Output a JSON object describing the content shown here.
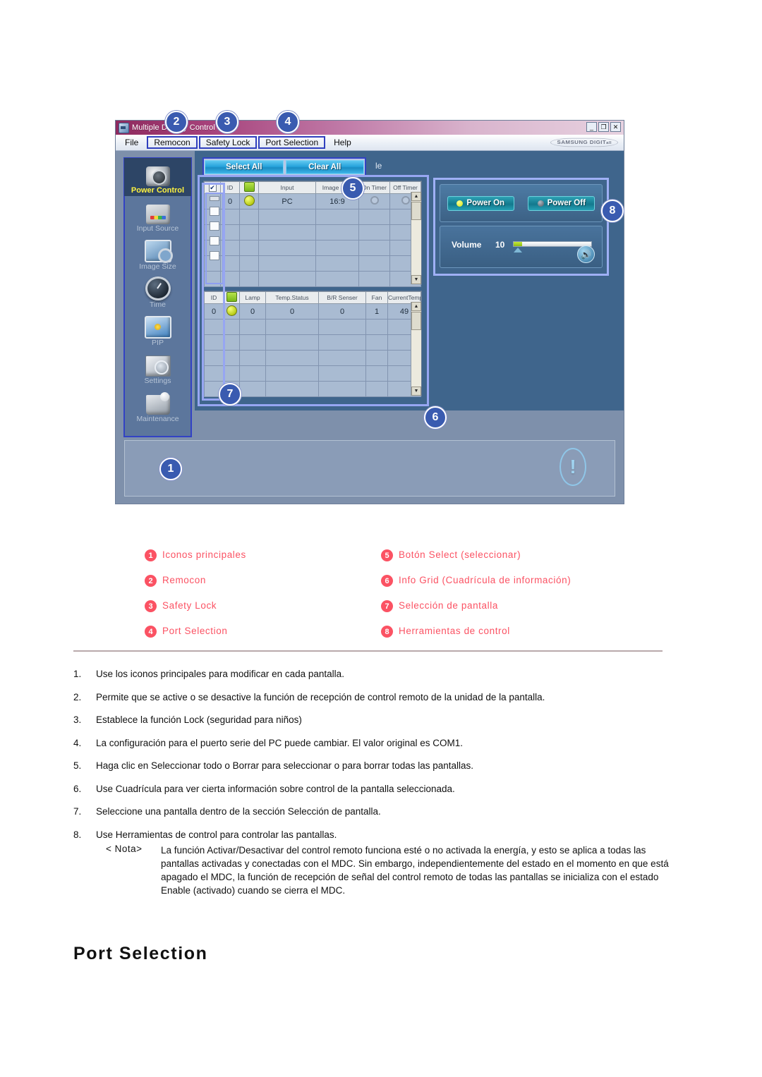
{
  "app": {
    "window_title": "Multiple Display Control",
    "window_buttons": {
      "minimize": "_",
      "maximize": "❐",
      "close": "✕"
    },
    "brand": "SAMSUNG DIGIT",
    "brand_suffix": "all",
    "menu": [
      {
        "label": "File",
        "boxed": false
      },
      {
        "label": "Remocon",
        "boxed": true
      },
      {
        "label": "Safety Lock",
        "boxed": true
      },
      {
        "label": "Port Selection",
        "boxed": true
      },
      {
        "label": "Help",
        "boxed": false
      }
    ],
    "rail": [
      {
        "label": "Power Control",
        "active": true
      },
      {
        "label": "Input Source",
        "active": false
      },
      {
        "label": "Image Size",
        "active": false
      },
      {
        "label": "Time",
        "active": false
      },
      {
        "label": "PIP",
        "active": false
      },
      {
        "label": "Settings",
        "active": false
      },
      {
        "label": "Maintenance",
        "active": false
      }
    ],
    "buttons": {
      "select_all": "Select All",
      "clear_all": "Clear All"
    },
    "grid_caption": "le",
    "grid_top": {
      "headers": [
        "",
        "ID",
        "",
        "Input",
        "Image Size",
        "On Timer",
        "Off Timer"
      ],
      "rows": [
        {
          "id": "0",
          "power": "on",
          "input": "PC",
          "image_size": "16:9",
          "on_timer": "",
          "off_timer": ""
        }
      ],
      "empty_rows": 5
    },
    "grid_bottom": {
      "headers": [
        "ID",
        "",
        "Lamp",
        "Temp.Status",
        "B/R Senser",
        "Fan",
        "CurrentTemp."
      ],
      "rows": [
        {
          "id": "0",
          "power": "on",
          "lamp": "0",
          "temp_status": "0",
          "br_senser": "0",
          "fan": "1",
          "current_temp": "49"
        }
      ],
      "empty_rows": 5
    },
    "tools": {
      "power_on": "Power On",
      "power_off": "Power Off",
      "volume_label": "Volume",
      "volume_value": "10"
    },
    "status_icon": "!",
    "callouts": [
      "1",
      "2",
      "3",
      "4",
      "5",
      "6",
      "7",
      "8"
    ]
  },
  "legend": {
    "left": [
      {
        "num": "1",
        "label": "Iconos principales"
      },
      {
        "num": "2",
        "label": "Remocon"
      },
      {
        "num": "3",
        "label": "Safety Lock"
      },
      {
        "num": "4",
        "label": "Port Selection"
      }
    ],
    "right": [
      {
        "num": "5",
        "label": "Botón Select (seleccionar)"
      },
      {
        "num": "6",
        "label": "Info Grid (Cuadrícula de información)"
      },
      {
        "num": "7",
        "label": "Selección de pantalla"
      },
      {
        "num": "8",
        "label": "Herramientas de control"
      }
    ]
  },
  "steps": [
    {
      "num": "1.",
      "text": "Use los iconos principales para modificar en cada pantalla."
    },
    {
      "num": "2.",
      "text": "Permite que se active o se desactive la función de recepción de control remoto de la unidad de la pantalla."
    },
    {
      "num": "3.",
      "text": "Establece la función Lock (seguridad para niños)"
    },
    {
      "num": "4.",
      "text": "La configuración para el puerto serie del PC puede cambiar. El valor original es COM1."
    },
    {
      "num": "5.",
      "text": "Haga clic en Seleccionar todo o Borrar para seleccionar o para borrar todas las pantallas."
    },
    {
      "num": "6.",
      "text": "Use Cuadrícula para ver cierta información sobre control de la pantalla seleccionada."
    },
    {
      "num": "7.",
      "text": "Seleccione una pantalla dentro de la sección Selección de pantalla."
    },
    {
      "num": "8.",
      "text": "Use Herramientas de control para controlar las pantallas."
    }
  ],
  "note": {
    "label": "< Nota>",
    "body": "La función Activar/Desactivar del control remoto funciona esté o no activada la energía, y esto se aplica a todas las pantallas activadas y conectadas con el MDC. Sin embargo, independientemente del estado en el momento en que está apagado el MDC, la función de recepción de señal del control remoto de todas las pantallas se inicializa con el estado Enable (activado) cuando se cierra el MDC."
  },
  "section_title": "Port Selection",
  "colors": {
    "callout_blue": "#3a5bb0",
    "legend_red": "#fb5263",
    "titlebar_magenta": "#8e2a5e",
    "app_body_blue": "#7e90ab",
    "teal_button": "#27a3dc",
    "highlight_yellow": "#fff33f"
  }
}
